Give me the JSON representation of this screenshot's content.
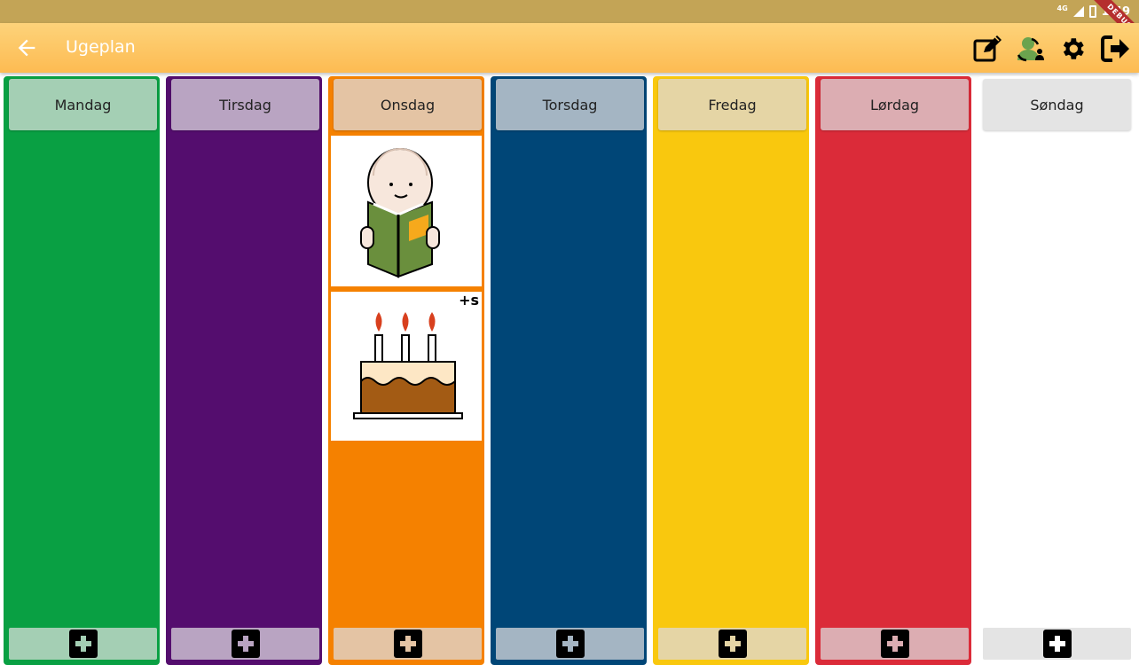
{
  "status_bar": {
    "network": "4G",
    "time": "1:49",
    "ribbon": "DEBUG"
  },
  "app_bar": {
    "title": "Ugeplan",
    "icons": [
      "arrow-back-icon",
      "edit-icon",
      "citizen-switch-icon",
      "gear-icon",
      "logout-icon"
    ]
  },
  "days": [
    {
      "name": "Mandag",
      "color": "#09a043",
      "header_color": "#a4cfb4",
      "footer_color": "#a4cfb4",
      "plus_color": "#a4cfb4"
    },
    {
      "name": "Tirsdag",
      "color": "#540d6e",
      "header_color": "#b9a4c2",
      "footer_color": "#b9a4c2",
      "plus_color": "#b9a4c2"
    },
    {
      "name": "Onsdag",
      "color": "#f58100",
      "header_color": "#e4c4a4",
      "footer_color": "#e4c4a4",
      "plus_color": "#e4c4a4",
      "activities": [
        {
          "pictogram": "reading-book-pictogram",
          "choice_mark": ""
        },
        {
          "pictogram": "birthday-cake-pictogram",
          "choice_mark": "+s"
        }
      ]
    },
    {
      "name": "Torsdag",
      "color": "#004677",
      "header_color": "#a4b5c3",
      "footer_color": "#a4b5c3",
      "plus_color": "#a4b5c3"
    },
    {
      "name": "Fredag",
      "color": "#f9c80e",
      "header_color": "#e5d5a5",
      "footer_color": "#e5d5a5",
      "plus_color": "#e5d5a5"
    },
    {
      "name": "Lørdag",
      "color": "#db2b39",
      "header_color": "#dcadb2",
      "footer_color": "#dcadb2",
      "plus_color": "#dcadb2"
    },
    {
      "name": "Søndag",
      "color": "#ffffff",
      "header_color": "#e4e4e4",
      "footer_color": "#e4e4e4",
      "plus_color": "#ffffff"
    }
  ]
}
